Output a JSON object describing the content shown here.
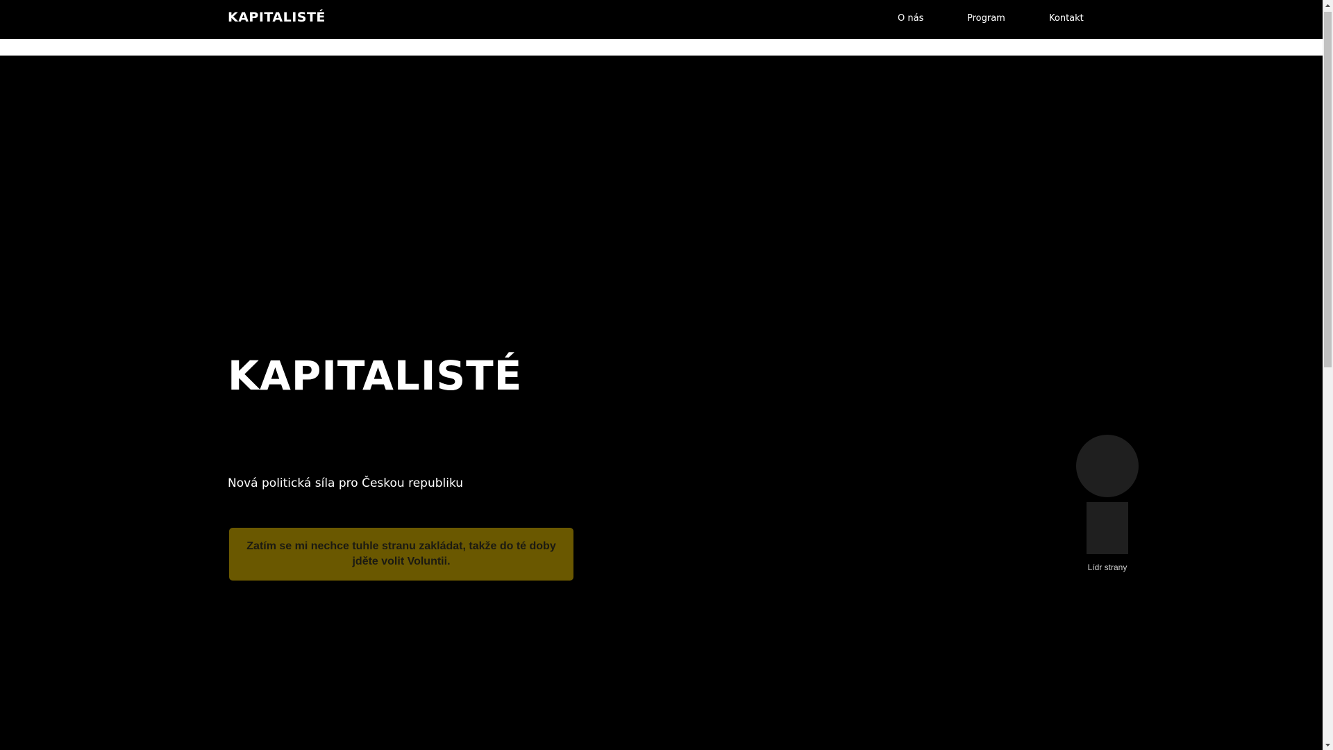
{
  "header": {
    "brand": "KAPITALISTÉ",
    "nav": [
      {
        "label": "O nás"
      },
      {
        "label": "Program"
      },
      {
        "label": "Kontakt"
      }
    ]
  },
  "hero": {
    "title": "KAPITALISTÉ",
    "subtitle": "Nová politická síla pro Českou republiku",
    "notice": "Zatím se mi nechce tuhle stranu zakládat, takže do té doby jděte volit Voluntii."
  },
  "leader": {
    "caption": "Lídr strany"
  },
  "scrollbar": {
    "position_fraction": 0
  },
  "colors": {
    "background": "#000000",
    "text": "#ffffff",
    "notice_bg": "#6a5800",
    "placeholder": "#1f1f1f"
  }
}
